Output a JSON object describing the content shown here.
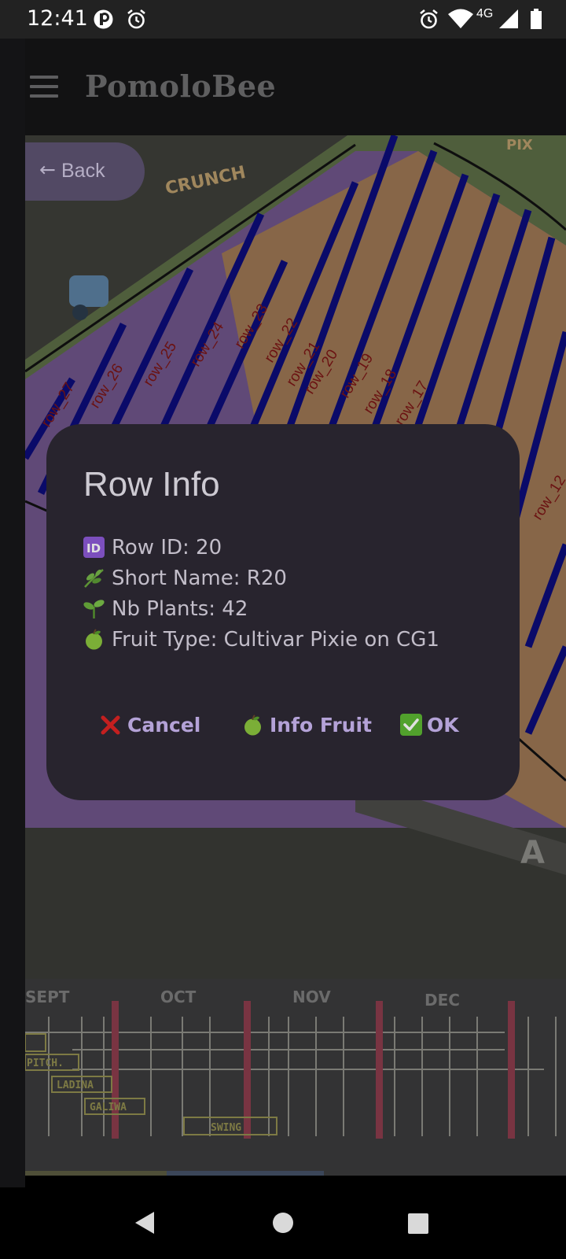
{
  "status_bar": {
    "time": "12:41",
    "network": "4G"
  },
  "app_bar": {
    "title": "PomoloBee"
  },
  "back_button": {
    "label": "Back"
  },
  "map": {
    "row_labels": [
      "row_27",
      "row_26",
      "row_25",
      "row_24",
      "row_23",
      "row_22",
      "row_21",
      "row_20",
      "row_19",
      "row_18",
      "row_17",
      "row_12"
    ],
    "orchard_labels": [
      "CRUNCH",
      "PIX"
    ]
  },
  "calendar": {
    "months": [
      "SEPT",
      "OCT",
      "NOV",
      "DEC"
    ],
    "varieties": [
      "PITCH.",
      "LADINA",
      "GALIWA",
      "SWING"
    ]
  },
  "dialog": {
    "title": "Row Info",
    "lines": [
      {
        "icon": "id-icon",
        "text": "Row ID: 20"
      },
      {
        "icon": "herb-icon",
        "text": "Short Name: R20"
      },
      {
        "icon": "seedling-icon",
        "text": "Nb Plants: 42"
      },
      {
        "icon": "green-apple-icon",
        "text": "Fruit Type: Cultivar Pixie on CG1"
      }
    ],
    "buttons": {
      "cancel": "Cancel",
      "info_fruit": "Info Fruit",
      "ok": "OK"
    }
  },
  "colors": {
    "dialog_bg": "#2e2a35",
    "button_text": "#cdb9f5",
    "row_line": "#0c0c78",
    "row_fill_a": "#7a5f9c",
    "row_fill_b": "#b58a5e"
  }
}
